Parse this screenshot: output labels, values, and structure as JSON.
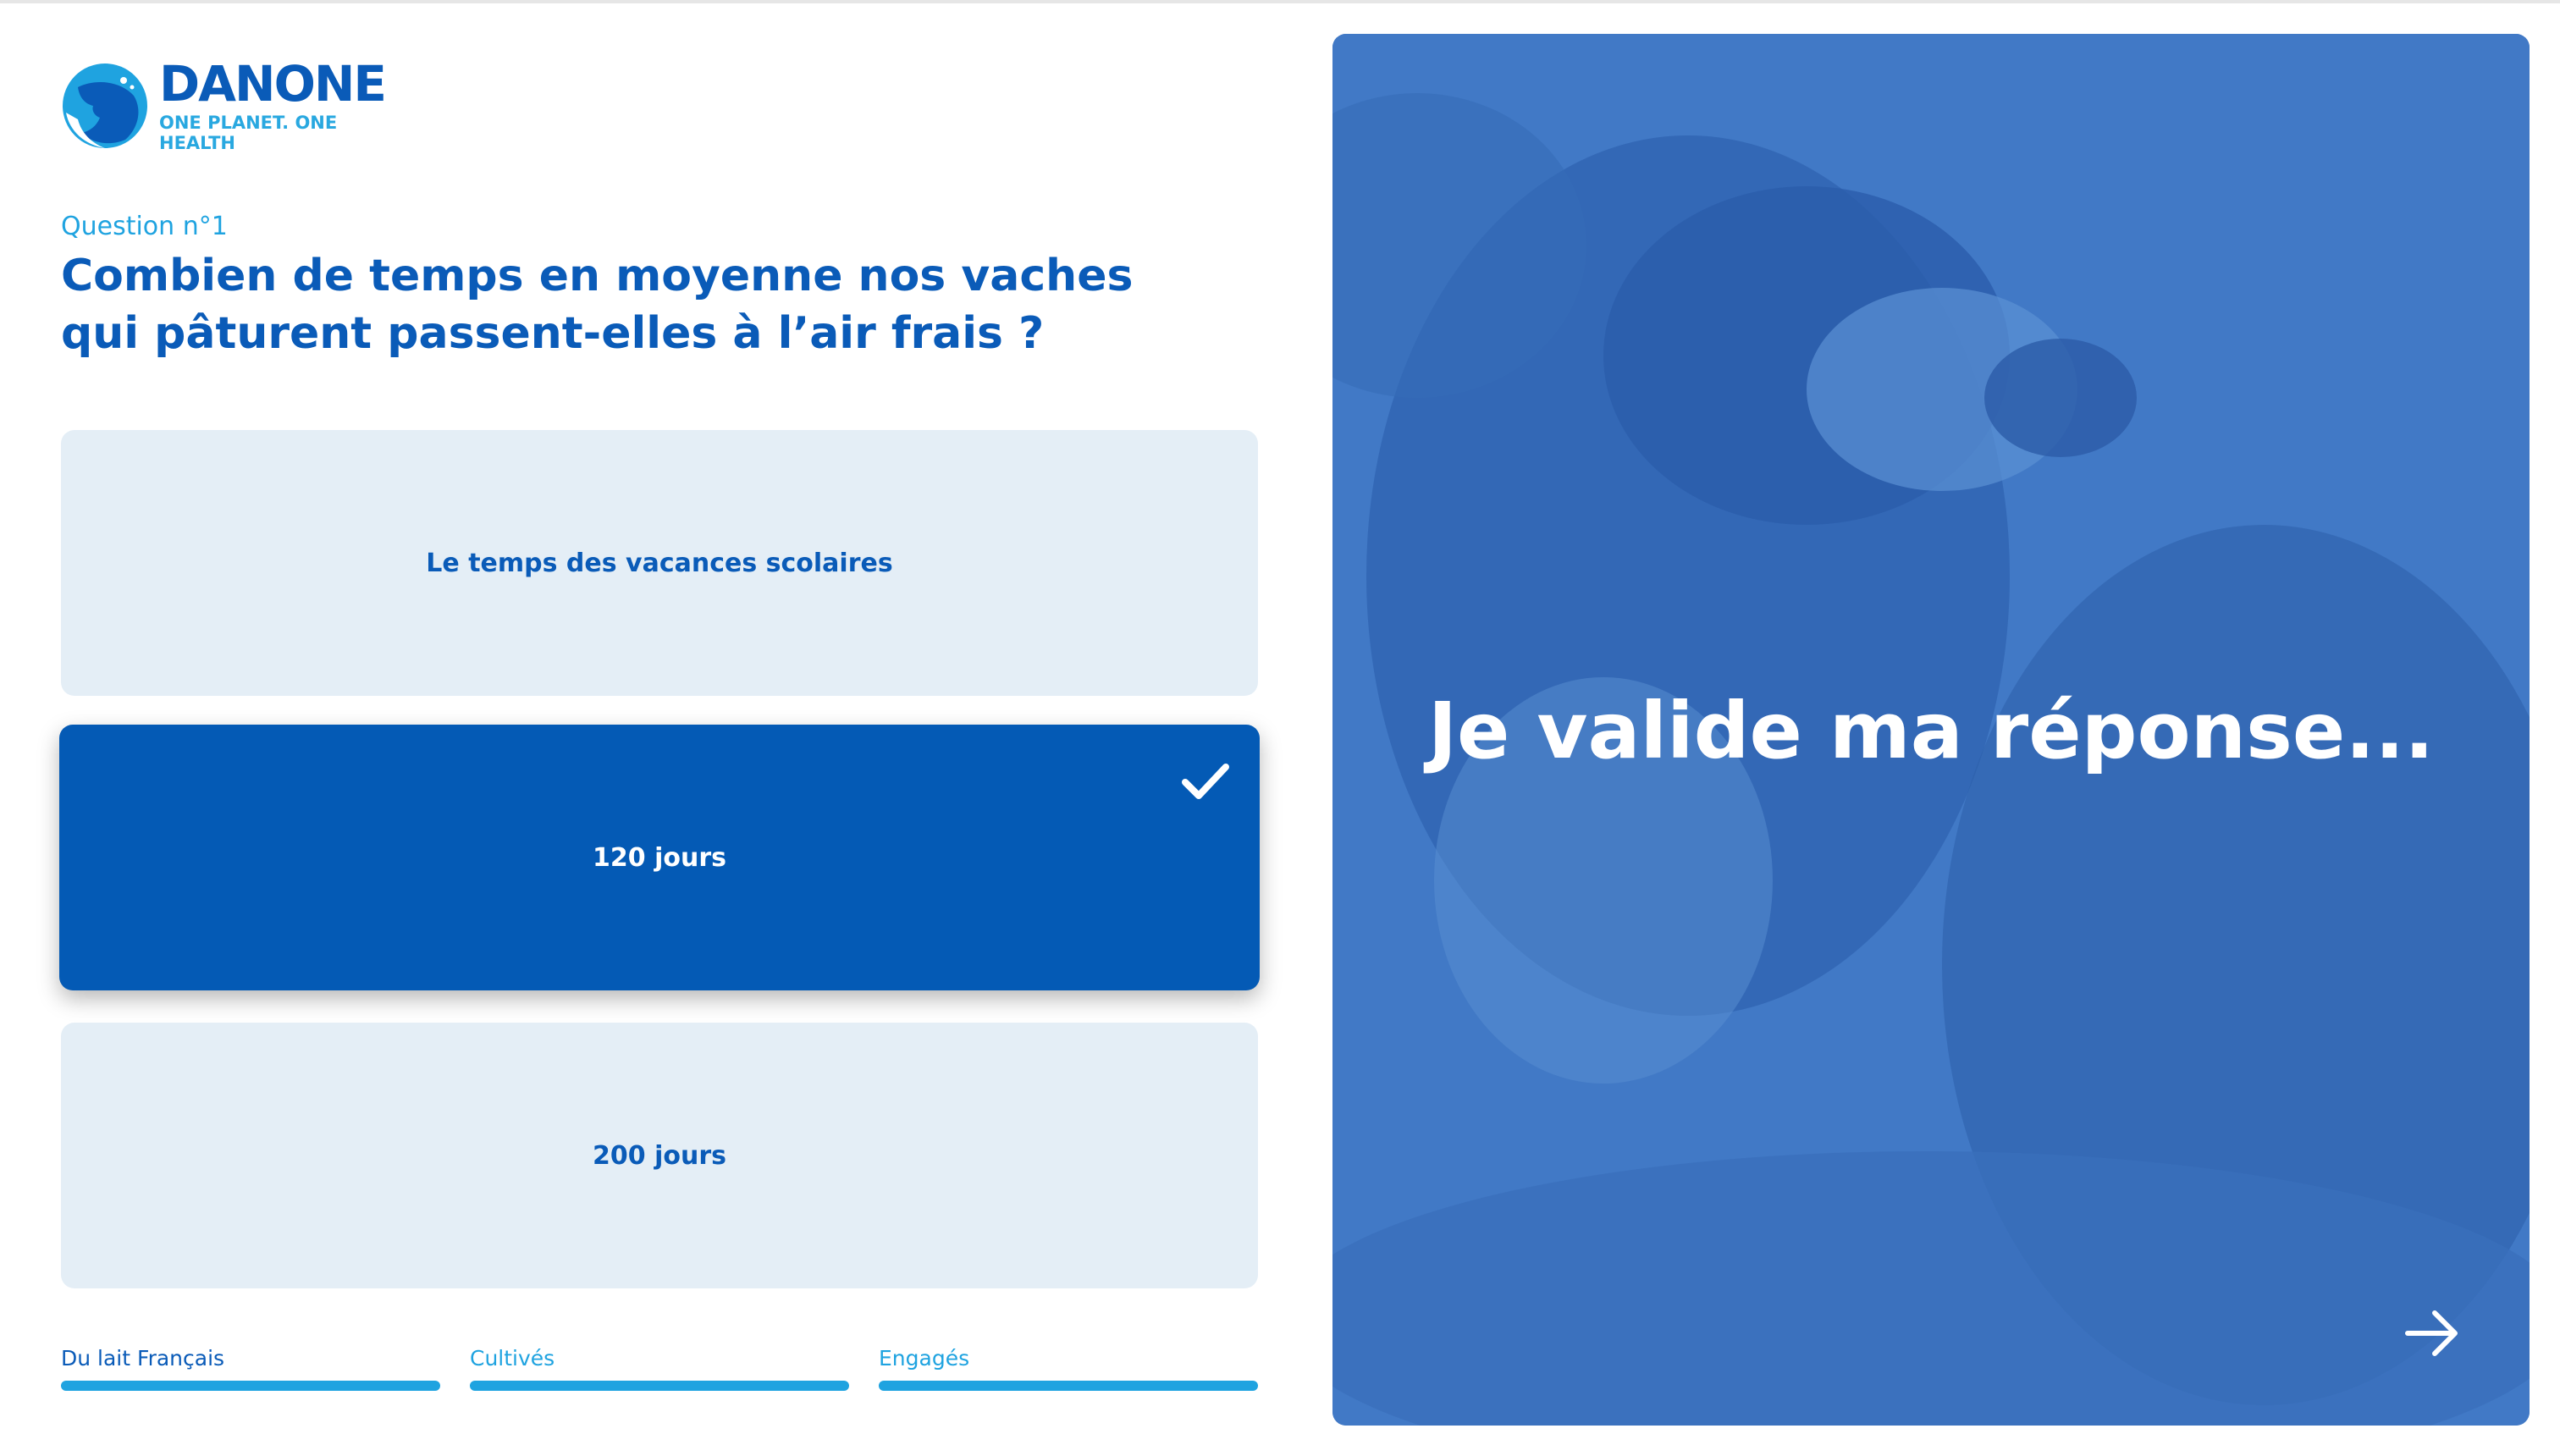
{
  "brand": {
    "name": "DANONE",
    "tagline": "ONE PLANET. ONE HEALTH"
  },
  "question": {
    "number": "Question n°1",
    "title": "Combien de temps en moyenne nos vaches qui pâturent passent-elles à l’air frais ?"
  },
  "answers": [
    {
      "label": "Le temps des vacances scolaires",
      "selected": false
    },
    {
      "label": "120 jours",
      "selected": true
    },
    {
      "label": "200 jours",
      "selected": false
    }
  ],
  "progress": [
    {
      "label": "Du lait Français",
      "active": true
    },
    {
      "label": "Cultivés",
      "active": false
    },
    {
      "label": "Engagés",
      "active": false
    }
  ],
  "panel": {
    "message": "Je valide ma réponse...",
    "next_icon": "arrow-right-icon"
  },
  "colors": {
    "brand_blue": "#0a5bb8",
    "accent_cyan": "#1fa3e0",
    "selected_blue": "#045ab5",
    "answer_bg": "#e4eef6",
    "panel_blue": "#3f7bc7"
  }
}
